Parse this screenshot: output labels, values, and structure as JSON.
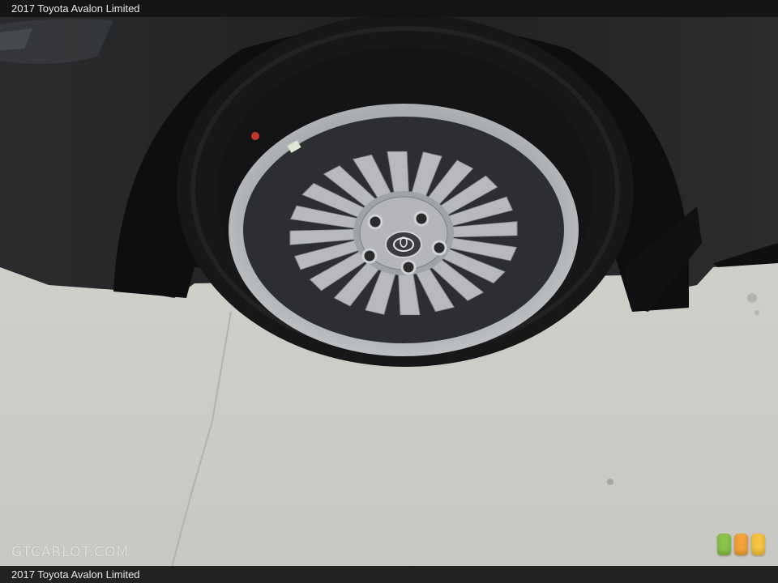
{
  "header": {
    "title": "2017 Toyota Avalon Limited"
  },
  "footer": {
    "caption": "2017 Toyota Avalon Limited"
  },
  "watermark": {
    "text": "GTCARLOT.COM"
  },
  "photo": {
    "subject": "wheel-photo",
    "colors": {
      "body_paint": "#1f1f20",
      "tire": "#171717",
      "rim": "#a2a4a7",
      "pavement": "#cfcdc8"
    }
  },
  "badge": {
    "icon": "rating-lights-icon",
    "colors": [
      "#8bc34a",
      "#f3a33a",
      "#f6c343"
    ]
  }
}
